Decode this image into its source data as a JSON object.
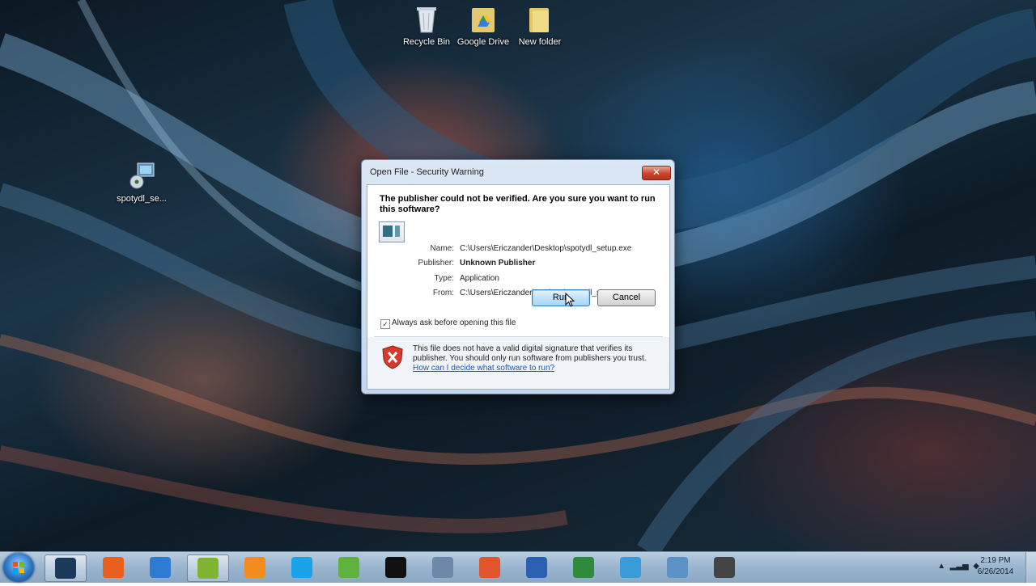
{
  "desktop": {
    "icons": [
      {
        "label": "Recycle Bin",
        "icon": "recycle-bin-icon"
      },
      {
        "label": "Google Drive",
        "icon": "google-drive-icon"
      },
      {
        "label": "New folder",
        "icon": "folder-icon"
      },
      {
        "label": "spotydl_se...",
        "icon": "setup-file-icon"
      }
    ]
  },
  "dialog": {
    "title": "Open File - Security Warning",
    "close_glyph": "✕",
    "headline": "The publisher could not be verified.  Are you sure you want to run this software?",
    "fields": [
      {
        "label": "Name:",
        "value": "C:\\Users\\Ericzander\\Desktop\\spotydl_setup.exe"
      },
      {
        "label": "Publisher:",
        "value": "Unknown Publisher"
      },
      {
        "label": "Type:",
        "value": "Application"
      },
      {
        "label": "From:",
        "value": "C:\\Users\\Ericzander\\Desktop\\spotydl_setup.exe"
      }
    ],
    "run_label": "Run",
    "cancel_label": "Cancel",
    "checkbox_checked": true,
    "checkbox_glyph": "✓",
    "checkbox_label": "Always ask before opening this file",
    "warning_text": "This file does not have a valid digital signature that verifies its publisher.  You should only run software from publishers you trust.",
    "link_text": "How can I decide what software to run?"
  },
  "taskbar": {
    "items": [
      {
        "name": "start-button"
      },
      {
        "name": "camtasia-icon",
        "color": "#1c3b5a"
      },
      {
        "name": "firefox-icon",
        "color": "#e8601c"
      },
      {
        "name": "internet-explorer-icon",
        "color": "#2d7cd1"
      },
      {
        "name": "spotify-icon",
        "color": "#7fb431"
      },
      {
        "name": "media-player-icon",
        "color": "#f28c1f"
      },
      {
        "name": "skype-icon",
        "color": "#1aa3e8"
      },
      {
        "name": "utorrent-icon",
        "color": "#5fb23e"
      },
      {
        "name": "video-player-icon",
        "color": "#111111"
      },
      {
        "name": "paint-icon",
        "color": "#6d88a8"
      },
      {
        "name": "powerpoint-icon",
        "color": "#e0552b"
      },
      {
        "name": "word-icon",
        "color": "#2b5fb3"
      },
      {
        "name": "excel-icon",
        "color": "#2f8a3b"
      },
      {
        "name": "video-editor-icon",
        "color": "#3a9bd9"
      },
      {
        "name": "explorer-icon",
        "color": "#5b93c7"
      },
      {
        "name": "calculator-icon",
        "color": "#444444"
      }
    ],
    "clock_time": "2:19 PM",
    "clock_date": "6/26/2014"
  }
}
